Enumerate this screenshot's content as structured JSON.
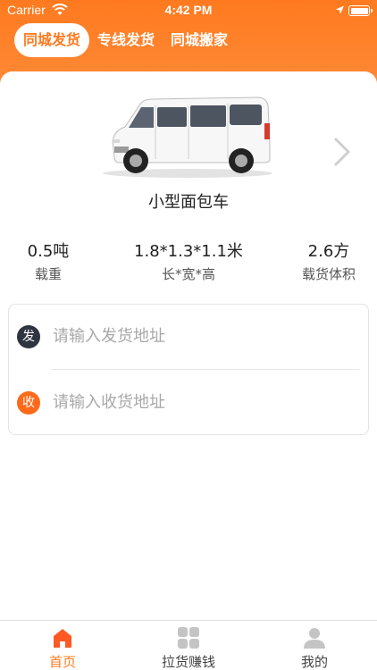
{
  "status_bar": {
    "carrier": "Carrier",
    "time": "4:42 PM"
  },
  "top_tabs": [
    {
      "label": "同城发货",
      "active": true
    },
    {
      "label": "专线发货",
      "active": false
    },
    {
      "label": "同城搬家",
      "active": false
    }
  ],
  "vehicle": {
    "name": "小型面包车",
    "specs": [
      {
        "value": "0.5吨",
        "label": "载重"
      },
      {
        "value": "1.8*1.3*1.1米",
        "label": "长*宽*高"
      },
      {
        "value": "2.6方",
        "label": "载货体积"
      }
    ]
  },
  "address": {
    "sender_badge": "发",
    "sender_placeholder": "请输入发货地址",
    "receiver_badge": "收",
    "receiver_placeholder": "请输入收货地址"
  },
  "tabbar": [
    {
      "label": "首页",
      "icon": "home-icon",
      "active": true
    },
    {
      "label": "拉货赚钱",
      "icon": "grid-icon",
      "active": false
    },
    {
      "label": "我的",
      "icon": "user-icon",
      "active": false
    }
  ],
  "colors": {
    "accent": "#ff7a1f",
    "sender_badge": "#2f3441",
    "receiver_badge": "#ff6a1a"
  }
}
